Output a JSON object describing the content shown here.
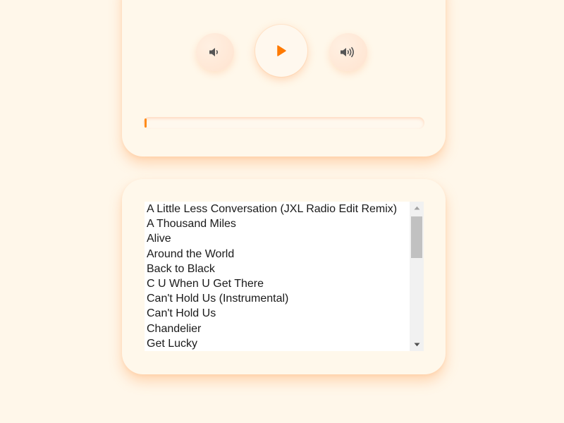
{
  "player": {
    "controls": {
      "volume_down_icon": "volume-down-icon",
      "play_icon": "play-icon",
      "volume_up_icon": "volume-up-icon"
    },
    "progress": 0.0,
    "accent_color": "#ff8c1a",
    "icon_color": "#555555"
  },
  "playlist": {
    "tracks": [
      "A Little Less Conversation (JXL Radio Edit Remix)",
      "A Thousand Miles",
      "Alive",
      "Around the World",
      "Back to Black",
      "C U When U Get There",
      "Can't Hold Us (Instrumental)",
      "Can't Hold Us",
      "Chandelier",
      "Get Lucky"
    ]
  },
  "colors": {
    "background": "#fff7ea",
    "card": "#fff8eb"
  }
}
